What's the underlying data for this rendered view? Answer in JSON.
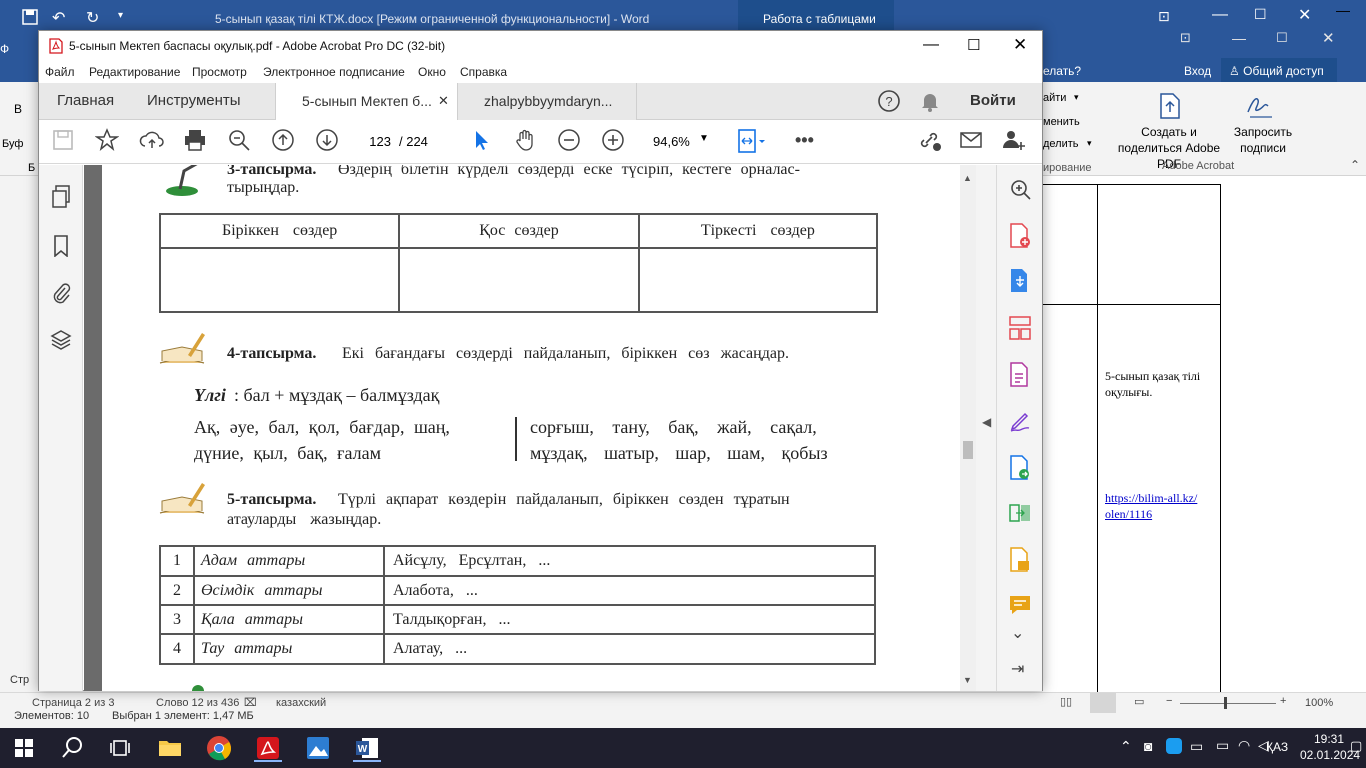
{
  "word": {
    "title": "5-сынып қазақ тілі КТЖ.docx [Режим ограниченной функциональности] - Word",
    "context_tab": "Работа с таблицами",
    "tell_me": "елать?",
    "login": "Вход",
    "share": "Общий доступ",
    "ribbon_items": [
      "айти",
      "менить",
      "делить"
    ],
    "editing_group": "ирование",
    "create_share_pdf": "Создать и поделиться Adobe PDF",
    "request_sign": "Запросить подписи",
    "adobe_group": "Adobe Acrobat",
    "left_stubs": [
      "Ф",
      "В",
      "Буф",
      "Б",
      "Стр"
    ],
    "doc_cell_text": "5-сынып қазақ тілі оқулығы.",
    "doc_link": "https://bilim-all.kz/olen/1116",
    "status": {
      "page": "Страница 2 из 3",
      "words": "Слово 12 из 436",
      "language": "казахский",
      "zoom": "100%"
    }
  },
  "explorer_status": {
    "items": "Элементов: 10",
    "selected": "Выбран 1 элемент: 1,47 МБ"
  },
  "acrobat": {
    "title": "5-сынып Мектеп баспасы оқулық.pdf - Adobe Acrobat Pro DC (32-bit)",
    "menu": [
      "Файл",
      "Редактирование",
      "Просмотр",
      "Электронное подписание",
      "Окно",
      "Справка"
    ],
    "tabs": {
      "home": "Главная",
      "tools": "Инструменты",
      "doc1": "5-сынып Мектеп б...",
      "doc2": "zhalpybbyymdaryn..."
    },
    "signin": "Войти",
    "page_current": "123",
    "page_total": "/ 224",
    "zoom": "94,6%"
  },
  "pdf": {
    "task3_label": "3-тапсырма.",
    "task3_text": "Өздерің білетін күрделі сөздерді еске түсіріп, кестеге орналас-",
    "task3_text2": "тырыңдар.",
    "table1_headers": [
      "Біріккен сөздер",
      "Қос сөздер",
      "Тіркесті сөздер"
    ],
    "task4_label": "4-тапсырма.",
    "task4_text": "Екі бағандағы сөздерді пайдаланып, біріккен сөз жасаңдар.",
    "example_label": "Үлгі",
    "example_text": ": бал + мұздақ – балмұздақ",
    "col_left": [
      "Ақ, әуе, бал, қол, бағдар, шаң,",
      "дүние, қыл, бақ, ғалам"
    ],
    "col_right": [
      "сорғыш, тану, бақ, жай, сақал,",
      "мұздақ, шатыр, шар, шам, қобыз"
    ],
    "task5_label": "5-тапсырма.",
    "task5_text": "Түрлі ақпарат көздерін пайдаланып, біріккен сөзден тұратын",
    "task5_text2": "атауларды жазыңдар.",
    "table2": [
      {
        "n": "1",
        "cat": "Адам аттары",
        "ex": "Айсұлу, Ерсұлтан, ..."
      },
      {
        "n": "2",
        "cat": "Өсімдік аттары",
        "ex": "Алабота, ..."
      },
      {
        "n": "3",
        "cat": "Қала аттары",
        "ex": "Талдықорған, ..."
      },
      {
        "n": "4",
        "cat": "Тау аттары",
        "ex": "Алатау, ..."
      }
    ]
  },
  "taskbar": {
    "lang": "ҚАЗ",
    "time": "19:31",
    "date": "02.01.2024"
  }
}
